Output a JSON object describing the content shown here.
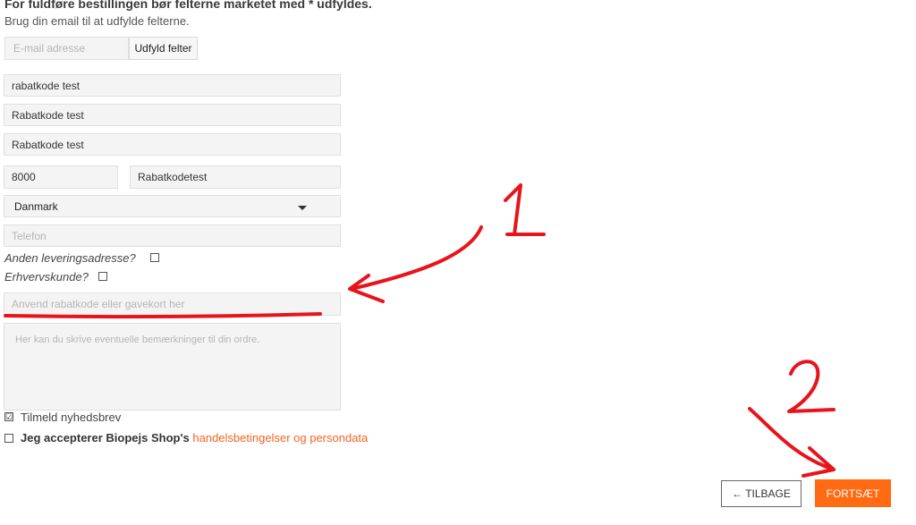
{
  "header": {
    "title": "For fuldføre bestillingen bør felterne marketet med * udfyldes.",
    "subtitle": "Brug din email til at udfylde felterne."
  },
  "autofill": {
    "email_placeholder": "E-mail adresse",
    "button_label": "Udfyld felter"
  },
  "fields": {
    "field1_value": "rabatkode test",
    "field2_value": "Rabatkode test",
    "field3_value": "Rabatkode test",
    "zip_value": "8000",
    "city_value": "Rabatkodetest",
    "country_selected": "Danmark",
    "phone_placeholder": "Telefon"
  },
  "options": {
    "alt_delivery_label": "Anden leveringsadresse?",
    "business_label": "Erhvervskunde?"
  },
  "discount": {
    "placeholder": "Anvend rabatkode eller gavekort her"
  },
  "comments": {
    "placeholder": "Her kan du skrive eventuelle bemærkninger til din ordre."
  },
  "consent": {
    "newsletter_label": "Tilmeld nyhedsbrev",
    "newsletter_check": "☑",
    "terms_prefix": "Jeg accepterer Biopejs Shop's ",
    "terms_link": "handelsbetingelser og persondata"
  },
  "actions": {
    "back_label": "← TILBAGE",
    "next_label": "FORTSÆT"
  },
  "annotations": {
    "marker1": "1",
    "marker2": "2",
    "color": "#e8141b"
  },
  "colors": {
    "accent": "#ff6a13",
    "link": "#f26522"
  }
}
